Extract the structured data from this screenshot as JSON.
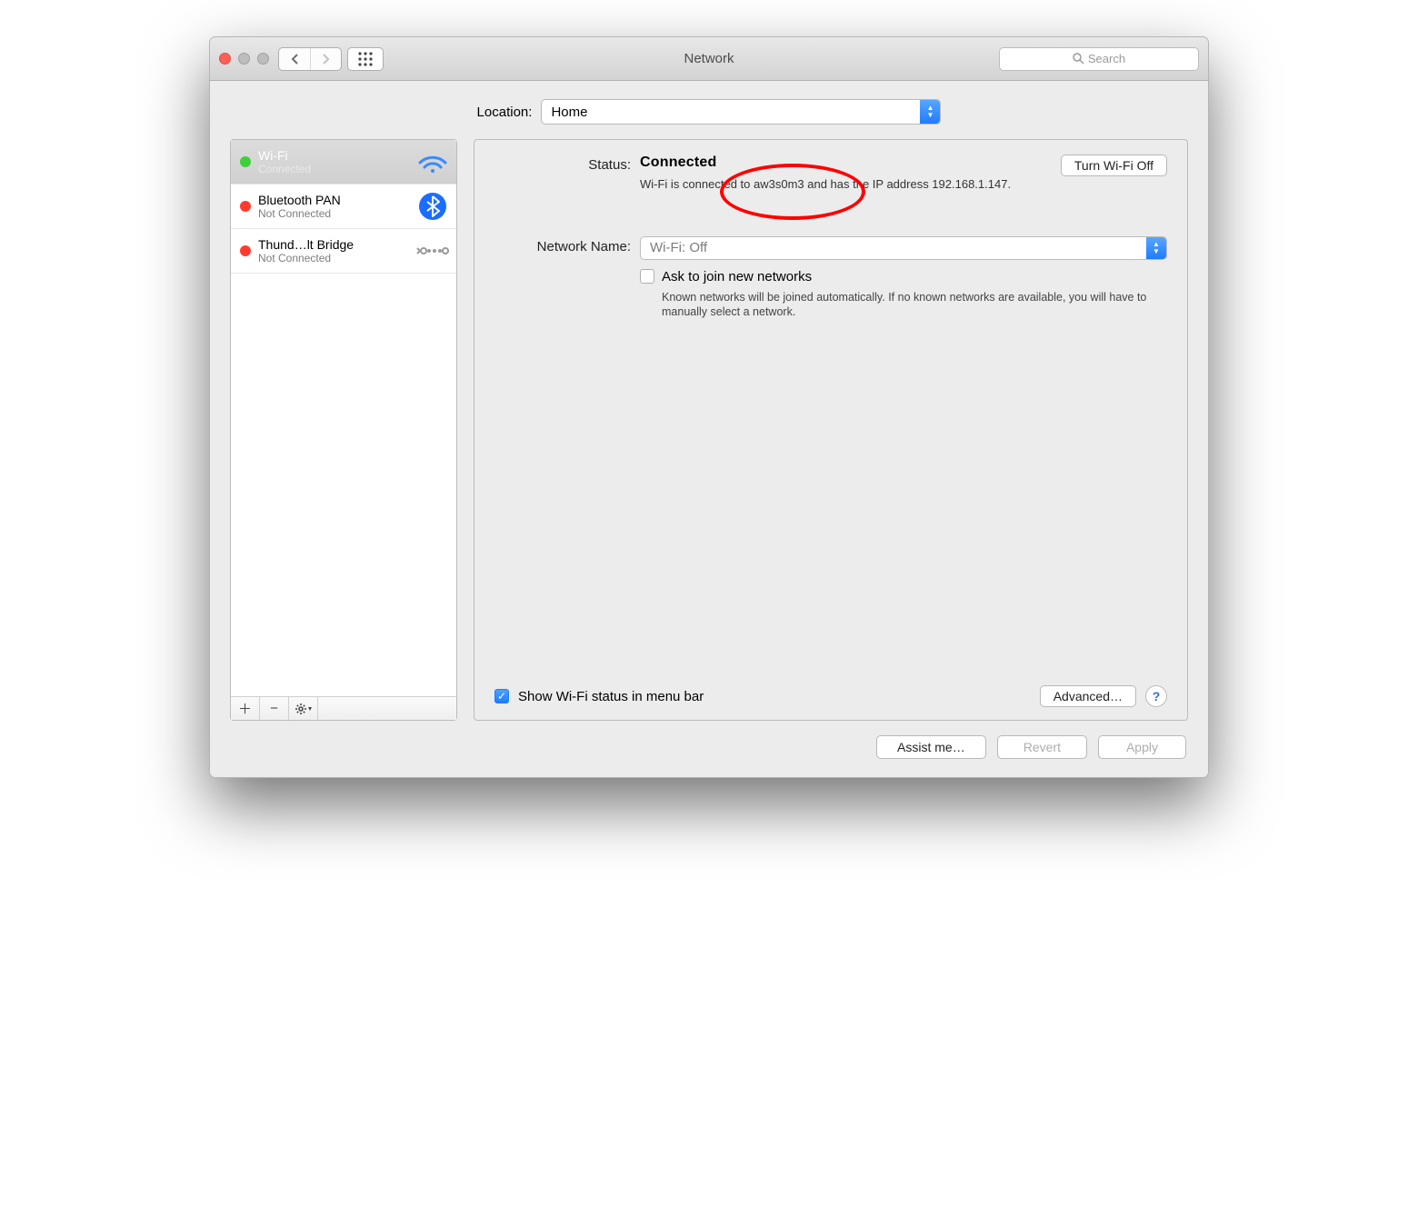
{
  "window": {
    "title": "Network",
    "search_placeholder": "Search"
  },
  "location": {
    "label": "Location:",
    "value": "Home"
  },
  "services": [
    {
      "name": "Wi-Fi",
      "status": "Connected",
      "color": "green",
      "icon": "wifi",
      "selected": true
    },
    {
      "name": "Bluetooth PAN",
      "status": "Not Connected",
      "color": "red",
      "icon": "bluetooth",
      "selected": false
    },
    {
      "name": "Thund…lt Bridge",
      "status": "Not Connected",
      "color": "red",
      "icon": "thunderbolt",
      "selected": false
    }
  ],
  "details": {
    "status_label": "Status:",
    "status_value": "Connected",
    "status_desc": "Wi-Fi is connected to aw3s0m3 and has the IP address 192.168.1.147.",
    "turn_off_btn": "Turn Wi-Fi Off",
    "network_name_label": "Network Name:",
    "network_name_value": "Wi-Fi: Off",
    "ask_join_label": "Ask to join new networks",
    "ask_join_desc": "Known networks will be joined automatically. If no known networks are available, you will have to manually select a network.",
    "show_status_label": "Show Wi-Fi status in menu bar",
    "advanced_btn": "Advanced…"
  },
  "footer": {
    "assist": "Assist me…",
    "revert": "Revert",
    "apply": "Apply"
  }
}
